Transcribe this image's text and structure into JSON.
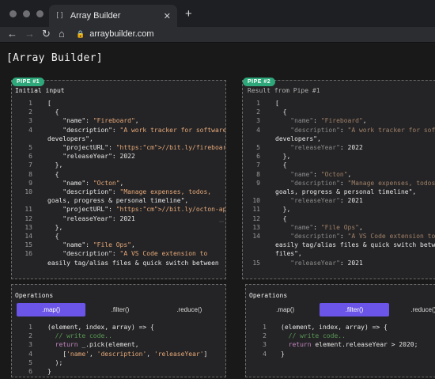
{
  "browser": {
    "tab_title": "Array Builder",
    "tab_favicon": "[]",
    "url": "arraybuilder.com"
  },
  "page": {
    "title": "[Array Builder]"
  },
  "pipe1": {
    "badge": "PIPE #1",
    "label": "Initial input",
    "lines": [
      {
        "n": "1",
        "t": "["
      },
      {
        "n": "2",
        "t": "  {"
      },
      {
        "n": "3",
        "t": "    \"name\": \"Fireboard\","
      },
      {
        "n": "4",
        "t": "    \"description\": \"A work tracker for software"
      },
      {
        "n": "",
        "t": "developers\","
      },
      {
        "n": "5",
        "t": "    \"projectURL\": \"https://bit.ly/fireboardapp\","
      },
      {
        "n": "6",
        "t": "    \"releaseYear\": 2022"
      },
      {
        "n": "7",
        "t": "  },"
      },
      {
        "n": "8",
        "t": "  {"
      },
      {
        "n": "9",
        "t": "    \"name\": \"Octon\","
      },
      {
        "n": "10",
        "t": "    \"description\": \"Manage expenses, todos,"
      },
      {
        "n": "",
        "t": "goals, progress & personal timeline\","
      },
      {
        "n": "11",
        "t": "    \"projectURL\": \"https://bit.ly/octon-app\","
      },
      {
        "n": "12",
        "t": "    \"releaseYear\": 2021"
      },
      {
        "n": "13",
        "t": "  },"
      },
      {
        "n": "14",
        "t": "  {"
      },
      {
        "n": "15",
        "t": "    \"name\": \"File Ops\","
      },
      {
        "n": "16",
        "t": "    \"description\": \"A VS Code extension to"
      },
      {
        "n": "",
        "t": "easily tag/alias files & quick switch between"
      }
    ]
  },
  "pipe2": {
    "badge": "PIPE #2",
    "label": "Result from Pipe #1",
    "lines": [
      {
        "n": "1",
        "t": "["
      },
      {
        "n": "2",
        "t": "  {"
      },
      {
        "n": "3",
        "t": "    \"name\": \"Fireboard\","
      },
      {
        "n": "4",
        "t": "    \"description\": \"A work tracker for softw"
      },
      {
        "n": "",
        "t": "developers\","
      },
      {
        "n": "5",
        "t": "    \"releaseYear\": 2022"
      },
      {
        "n": "6",
        "t": "  },"
      },
      {
        "n": "7",
        "t": "  {"
      },
      {
        "n": "8",
        "t": "    \"name\": \"Octon\","
      },
      {
        "n": "9",
        "t": "    \"description\": \"Manage expenses, todos,"
      },
      {
        "n": "",
        "t": "goals, progress & personal timeline\","
      },
      {
        "n": "10",
        "t": "    \"releaseYear\": 2021"
      },
      {
        "n": "11",
        "t": "  },"
      },
      {
        "n": "12",
        "t": "  {"
      },
      {
        "n": "13",
        "t": "    \"name\": \"File Ops\","
      },
      {
        "n": "14",
        "t": "    \"description\": \"A VS Code extension to"
      },
      {
        "n": "",
        "t": "easily tag/alias files & quick switch betwee"
      },
      {
        "n": "",
        "t": "files\","
      },
      {
        "n": "15",
        "t": "    \"releaseYear\": 2021"
      }
    ]
  },
  "ops1": {
    "label": "Operations",
    "tabs": [
      ".map()",
      ".filter()",
      ".reduce()"
    ],
    "active": 0,
    "lines": [
      {
        "n": "1",
        "t": "(element, index, array) => {"
      },
      {
        "n": "2",
        "t": "  // write code.."
      },
      {
        "n": "3",
        "t": "  return _.pick(element,"
      },
      {
        "n": "4",
        "t": "    ['name', 'description', 'releaseYear']"
      },
      {
        "n": "5",
        "t": "  );"
      },
      {
        "n": "6",
        "t": "}"
      }
    ]
  },
  "ops2": {
    "label": "Operations",
    "tabs": [
      ".map()",
      ".filter()",
      ".reduce()"
    ],
    "active": 1,
    "lines": [
      {
        "n": "1",
        "t": "(element, index, array) => {"
      },
      {
        "n": "2",
        "t": "  // write code.."
      },
      {
        "n": "3",
        "t": "  return element.releaseYear > 2020;"
      },
      {
        "n": "4",
        "t": "}"
      }
    ]
  },
  "colors": {
    "accent": "#6a55e8",
    "badge": "#2ea87a"
  }
}
